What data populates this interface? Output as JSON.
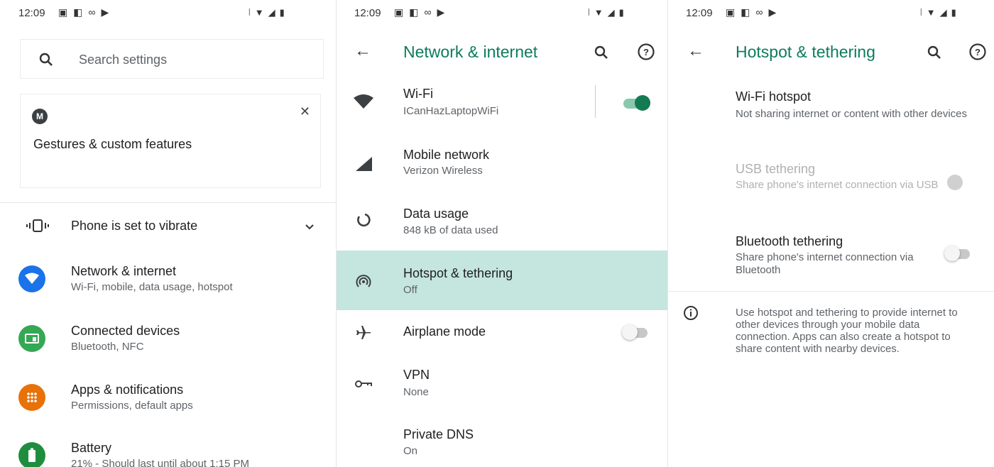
{
  "status_time": "12:09",
  "panel1": {
    "search_placeholder": "Search settings",
    "card_title": "Gestures & custom features",
    "card_logo": "M",
    "vibrate_label": "Phone is set to vibrate",
    "items": [
      {
        "title": "Network & internet",
        "subtitle": "Wi-Fi, mobile, data usage, hotspot",
        "icon": "network-icon",
        "color": "#1a73e8"
      },
      {
        "title": "Connected devices",
        "subtitle": "Bluetooth, NFC",
        "icon": "devices-icon",
        "color": "#34a853"
      },
      {
        "title": "Apps & notifications",
        "subtitle": "Permissions, default apps",
        "icon": "apps-icon",
        "color": "#e8710a"
      },
      {
        "title": "Battery",
        "subtitle": "21% - Should last until about 1:15 PM",
        "icon": "battery-icon",
        "color": "#1e8e3e"
      }
    ]
  },
  "panel2": {
    "title": "Network & internet",
    "items": [
      {
        "title": "Wi-Fi",
        "subtitle": "ICanHazLaptopWiFi",
        "toggle": "on"
      },
      {
        "title": "Mobile network",
        "subtitle": "Verizon Wireless"
      },
      {
        "title": "Data usage",
        "subtitle": "848 kB of data used"
      },
      {
        "title": "Hotspot & tethering",
        "subtitle": "Off",
        "highlighted": true
      },
      {
        "title": "Airplane mode",
        "subtitle": "",
        "toggle": "off"
      },
      {
        "title": "VPN",
        "subtitle": "None"
      },
      {
        "title": "Private DNS",
        "subtitle": "On"
      }
    ]
  },
  "panel3": {
    "title": "Hotspot & tethering",
    "items": [
      {
        "title": "Wi-Fi hotspot",
        "subtitle": "Not sharing internet or content with other devices"
      },
      {
        "title": "USB tethering",
        "subtitle": "Share phone's internet connection via USB",
        "disabled": true,
        "toggle": "off"
      },
      {
        "title": "Bluetooth tethering",
        "subtitle": "Share phone's internet connection via Bluetooth",
        "toggle": "off"
      }
    ],
    "info_text": "Use hotspot and tethering to provide internet to other devices through your mobile data connection. Apps can also create a hotspot to share content with nearby devices."
  },
  "colors": {
    "accent": "#0d7c5c",
    "highlight": "#c5e5df",
    "toggle_on": "#137a52"
  }
}
